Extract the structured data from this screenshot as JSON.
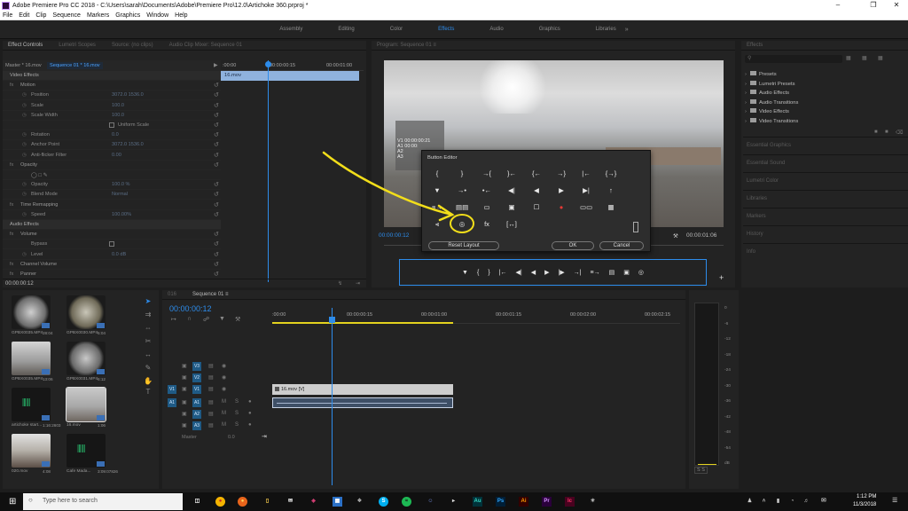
{
  "window": {
    "title": "Adobe Premiere Pro CC 2018 - C:\\Users\\sarah\\Documents\\Adobe\\Premiere Pro\\12.0\\Artichoke 360.prproj *"
  },
  "menu": [
    "File",
    "Edit",
    "Clip",
    "Sequence",
    "Markers",
    "Graphics",
    "Window",
    "Help"
  ],
  "workspaces": {
    "items": [
      "Assembly",
      "Editing",
      "Color",
      "Effects",
      "Audio",
      "Graphics",
      "Libraries"
    ],
    "active": "Effects",
    "more": "»"
  },
  "effect_controls": {
    "tabs": [
      "Effect Controls",
      "Lumetri Scopes",
      "Source: (no clips)",
      "Audio Clip Mixer: Sequence 01"
    ],
    "master_label": "Master * 16.mov",
    "sequence_label": "Sequence 01 * 16.mov",
    "mini_ruler": {
      "t0": ":00:00",
      "t1": "00:00:00:15",
      "t2": "00:00:01:00"
    },
    "clip_name": "16.mov",
    "rows": [
      {
        "label": "Video Effects",
        "value": "",
        "type": "hdr"
      },
      {
        "label": "Motion",
        "value": "",
        "type": "sec"
      },
      {
        "label": "Position",
        "value": "3072.0    1536.0",
        "type": "prop"
      },
      {
        "label": "Scale",
        "value": "100.0",
        "type": "prop"
      },
      {
        "label": "Scale Width",
        "value": "100.0",
        "type": "prop"
      },
      {
        "label": "Uniform Scale",
        "value": "",
        "type": "check"
      },
      {
        "label": "Rotation",
        "value": "0.0",
        "type": "prop"
      },
      {
        "label": "Anchor Point",
        "value": "3072.0    1536.0",
        "type": "prop"
      },
      {
        "label": "Anti-flicker Filter",
        "value": "0.00",
        "type": "prop"
      },
      {
        "label": "Opacity",
        "value": "",
        "type": "sec"
      },
      {
        "label": "",
        "value": "",
        "type": "masks"
      },
      {
        "label": "Opacity",
        "value": "100.0 %",
        "type": "prop"
      },
      {
        "label": "Blend Mode",
        "value": "Normal",
        "type": "prop"
      },
      {
        "label": "Time Remapping",
        "value": "",
        "type": "sec"
      },
      {
        "label": "Speed",
        "value": "100.00%",
        "type": "prop"
      },
      {
        "label": "Audio Effects",
        "value": "",
        "type": "hdr"
      },
      {
        "label": "Volume",
        "value": "",
        "type": "sec"
      },
      {
        "label": "Bypass",
        "value": "",
        "type": "check"
      },
      {
        "label": "Level",
        "value": "0.0  dB",
        "type": "prop"
      },
      {
        "label": "Channel Volume",
        "value": "",
        "type": "sec"
      },
      {
        "label": "Panner",
        "value": "",
        "type": "sec"
      }
    ],
    "timecode": "00:00:00:12"
  },
  "program": {
    "tab": "Program: Sequence 01 ≡",
    "overlay": {
      "line1": "V1 00:00:00:21",
      "line2": "A1 00:00:",
      "line3": "A2",
      "line4": "A3"
    },
    "timecode_left": "00:00:00:12",
    "timecode_right": "00:00:01:06"
  },
  "button_editor": {
    "title": "Button Editor",
    "row1": [
      "{",
      "}",
      "→{",
      "}←",
      "{←",
      "→}",
      "|←",
      "{→}"
    ],
    "row2": [
      "▼",
      "→•",
      "•←",
      "◀|",
      "◀",
      "▶",
      "▶|",
      "↑"
    ],
    "row3": [
      "≡→",
      "▤▤",
      "▭",
      "▣",
      "☐",
      "●",
      "▭▭",
      "▦"
    ],
    "row4": [
      "⫷",
      "◎",
      "fx",
      "[↔]"
    ],
    "reset_label": "Reset Layout",
    "ok_label": "OK",
    "cancel_label": "Cancel"
  },
  "transport": [
    "▼",
    "{",
    "}",
    "|←",
    "◀|",
    "◀",
    "▶",
    "|▶",
    "→|",
    "≡→",
    "▤",
    "▣",
    "◎"
  ],
  "effects_panel": {
    "title": "Effects",
    "items": [
      "Presets",
      "Lumetri Presets",
      "Audio Effects",
      "Audio Transitions",
      "Video Effects",
      "Video Transitions"
    ],
    "tabs": [
      "Essential Graphics",
      "Essential Sound",
      "Lumetri Color",
      "Libraries",
      "Markers",
      "History",
      "Info"
    ]
  },
  "project": {
    "items": [
      {
        "name": "GPBX0035.MP4",
        "dur": "28:04"
      },
      {
        "name": "GPBX0030.MP4",
        "dur": "5:04"
      },
      {
        "name": "GPBX0035.MP4",
        "dur": "13:06"
      },
      {
        "name": "GPBX0031.MP4",
        "dur": "6:12"
      },
      {
        "name": "artichoke start...",
        "dur": "1:16:2603"
      },
      {
        "name": "16.mov",
        "dur": "1:06"
      },
      {
        "name": "020.mov",
        "dur": "4:08"
      },
      {
        "name": "Cafe Mada...",
        "dur": "3:09:07826"
      }
    ]
  },
  "timeline": {
    "tabs": [
      "016",
      "Sequence 01 ≡"
    ],
    "timecode": "00:00:00:12",
    "ruler": [
      ":00:00",
      "00:00:00:15",
      "00:00:01:00",
      "00:00:01:15",
      "00:00:02:00",
      "00:00:02:15"
    ],
    "video_clip": "16.mov [V]",
    "tracks": [
      "V3",
      "V2",
      "V1",
      "A1",
      "A2",
      "A3"
    ],
    "master_label": "Master",
    "master_val": "0.0"
  },
  "meter": {
    "scale": [
      "0",
      "-6",
      "-12",
      "-18",
      "-24",
      "-30",
      "-36",
      "-42",
      "-48",
      "-54",
      "dB"
    ],
    "solo": "S  S"
  },
  "taskbar": {
    "search": "Type here to search",
    "time": "1:12 PM",
    "date": "11/3/2018"
  },
  "colors": {
    "accent": "#2d8ceb",
    "annotation": "#f2de1a",
    "record": "#e53935",
    "clip_video": "#cdcdcd",
    "clip_audio": "#3e4f66"
  }
}
